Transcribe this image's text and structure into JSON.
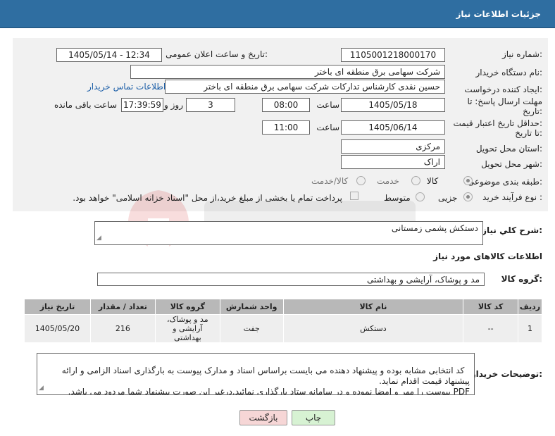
{
  "header": {
    "title": "جزئیات اطلاعات نیاز"
  },
  "labels": {
    "need_number": "شماره نیاز:",
    "announce_datetime": "تاریخ و ساعت اعلان عمومی:",
    "buyer_org": "نام دستگاه خریدار:",
    "requester": "ایجاد کننده درخواست:",
    "reply_deadline_1": "مهلت ارسال پاسخ: تا",
    "reply_deadline_2": "تاریخ:",
    "price_validity_1": "حداقل تاریخ اعتبار قیمت:",
    "price_validity_2": "تا تاریخ:",
    "time": "ساعت",
    "day_and": "روز و",
    "remaining_time": "ساعت باقی مانده",
    "delivery_province": "استان محل تحویل:",
    "delivery_city": "شهر محل تحویل:",
    "category": "طبقه بندی موضوعی:",
    "process_type": "نوع فرآیند خرید :",
    "general_desc": "شرح کلي نياز:",
    "goods_info": "اطلاعات کالاهای مورد نیاز",
    "goods_group": "گروه کالا:",
    "buyer_notes": "توضیحات خریدار:"
  },
  "fields": {
    "need_number": "1105001218000170",
    "announce_datetime": "1405/05/14 - 12:34",
    "buyer_org": "شرکت سهامی برق منطقه ای باختر",
    "requester": "حسین نقدی کارشناس تدارکات شرکت سهامی برق منطقه ای باختر",
    "contact_link": "اطلاعات تماس خریدار",
    "reply_date": "1405/05/18",
    "reply_time": "08:00",
    "days": "3",
    "remaining": "17:39:59",
    "validity_date": "1405/06/14",
    "validity_time": "11:00",
    "province": "مرکزی",
    "city": "اراک",
    "general_desc": "دستکش پشمی زمستانی",
    "goods_group": "مد و پوشاک، آرایشی و بهداشتی",
    "buyer_notes": "کد انتخابی مشابه بوده و پیشنهاد دهنده می بایست براساس اسناد و مدارک پیوست به بارگذاری اسناد الزامی و ارائه پیشنهاد قیمت اقدام نماید.\nPDF پیوست را مهر و امضا نموده و در سامانه ستاد بارگذاری نمائید.درغیر این صورت پیشنهاد شما مردود می باشد."
  },
  "category_options": [
    "کالا",
    "خدمت",
    "کالا/خدمت"
  ],
  "process_options": [
    "جزیی",
    "متوسط"
  ],
  "payment_note": "پرداخت تمام یا بخشی از مبلغ خرید،از محل \"اسناد خزانه اسلامی\" خواهد بود.",
  "table": {
    "headers": [
      "ردیف",
      "کد کالا",
      "نام کالا",
      "واحد شمارش",
      "گروه کالا",
      "تعداد / مقدار",
      "تاریخ نیاز"
    ],
    "rows": [
      [
        "1",
        "--",
        "دستکش",
        "جفت",
        "مد و پوشاک، آرایشی و بهداشتی",
        "216",
        "1405/05/20"
      ]
    ]
  },
  "buttons": {
    "back": "بازگشت",
    "print": "چاپ"
  },
  "colors": {
    "header": "#2f6ea1",
    "panel": "#f1f1f1",
    "link": "#1d5fa8",
    "back_btn": "#f6d6d6",
    "print_btn": "#d7f2d3"
  }
}
